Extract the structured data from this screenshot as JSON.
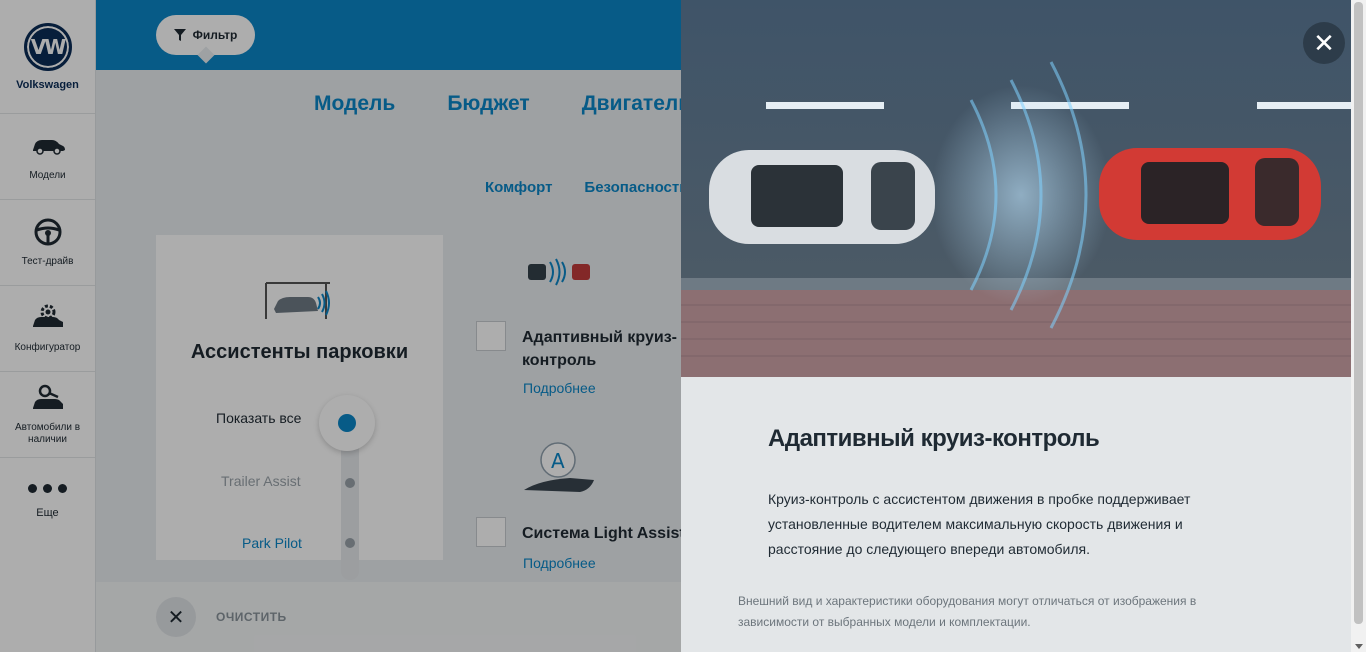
{
  "sidebar": {
    "brand": "Volkswagen",
    "items": [
      {
        "label": "Модели",
        "icon": "car-icon"
      },
      {
        "label": "Тест-драйв",
        "icon": "steering-wheel-icon"
      },
      {
        "label": "Конфигуратор",
        "icon": "car-gear-icon"
      },
      {
        "label": "Автомобили в наличии",
        "icon": "car-key-icon"
      }
    ],
    "more": "Еще"
  },
  "header": {
    "filter_label": "Фильтр"
  },
  "tabs": [
    "Модель",
    "Бюджет",
    "Двигатель"
  ],
  "subtabs": [
    "Комфорт",
    "Безопасность"
  ],
  "parking": {
    "title": "Ассистенты парковки",
    "options": [
      "Показать все",
      "Trailer Assist",
      "Park Pilot"
    ]
  },
  "features": [
    {
      "title": "Адаптивный круиз-контроль",
      "link": "Подробнее"
    },
    {
      "title": "Система Light Assist",
      "link": "Подробнее"
    }
  ],
  "clear_label": "ОЧИСТИТЬ",
  "modal": {
    "title": "Адаптивный круиз-контроль",
    "description": "Круиз-контроль с ассистентом движения в пробке поддерживает установленные водителем максимальную скорость движения и расстояние до следующего впереди автомобиля.",
    "note": "Внешний вид и характеристики оборудования могут отличаться от изображения в зависимости от выбранных модели и комплектации.",
    "close": "✕"
  },
  "colors": {
    "accent": "#0b86c8",
    "brand": "#0b2d57"
  }
}
